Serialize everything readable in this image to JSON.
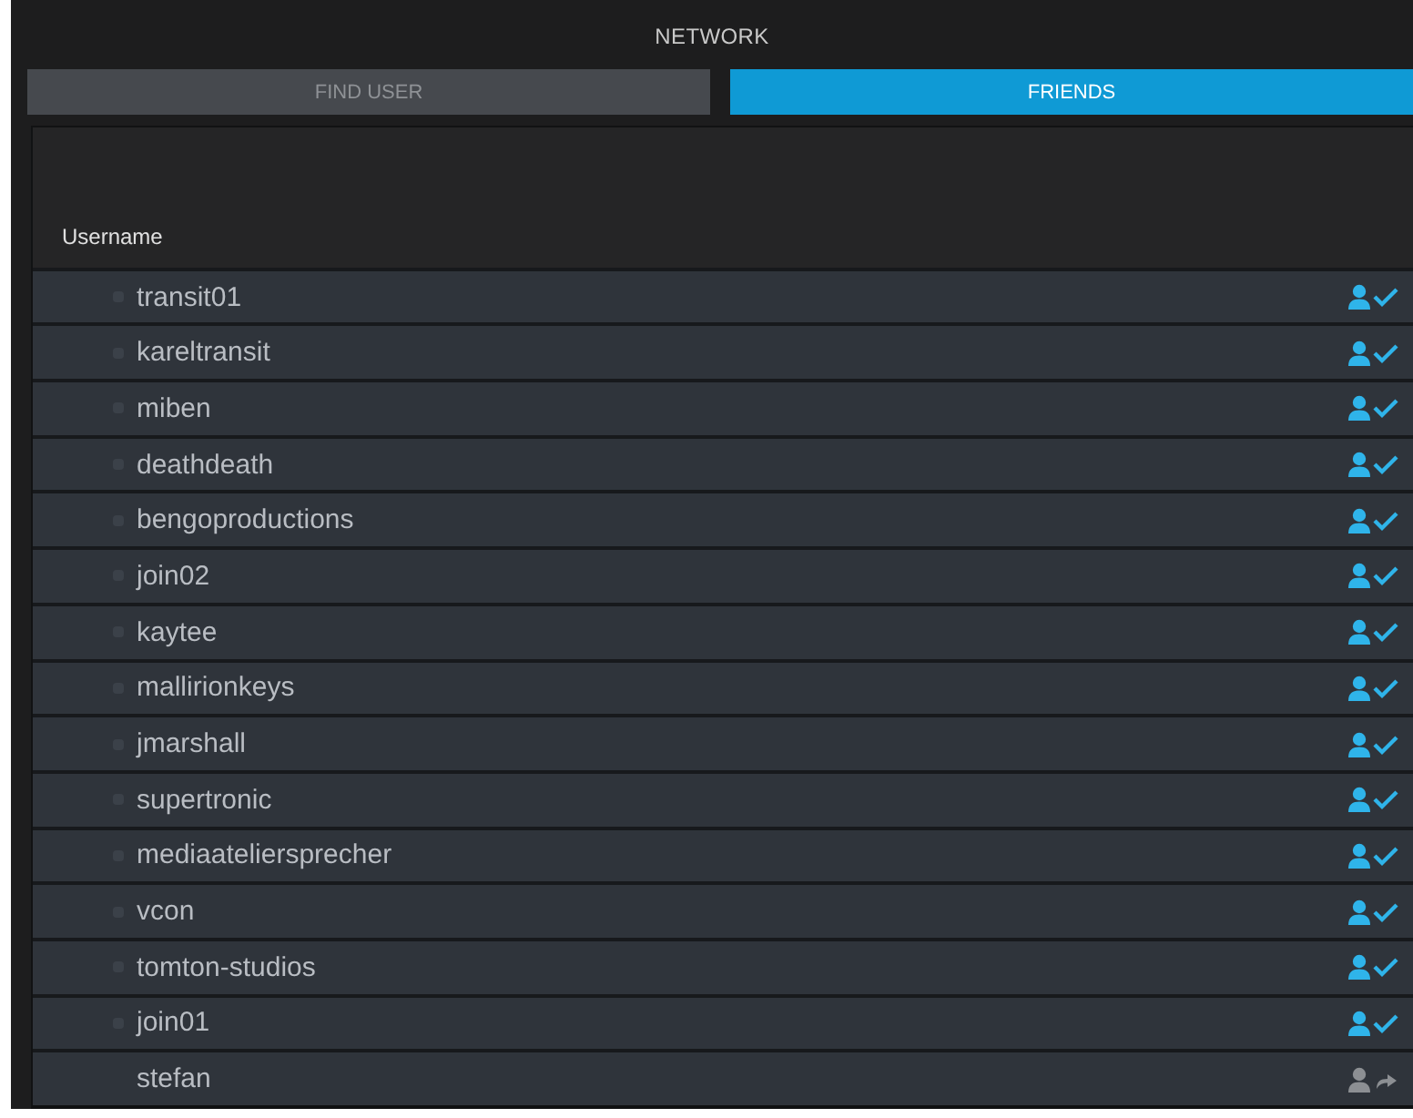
{
  "window": {
    "title": "NETWORK"
  },
  "tabs": [
    {
      "label": "FIND USER",
      "selected": false
    },
    {
      "label": "FRIENDS",
      "selected": true
    }
  ],
  "table": {
    "columns": [
      "Username"
    ],
    "rows": [
      {
        "username": "transit01",
        "marker": true,
        "kind": "friend"
      },
      {
        "username": "kareltransit",
        "marker": true,
        "kind": "friend"
      },
      {
        "username": "miben",
        "marker": true,
        "kind": "friend"
      },
      {
        "username": "deathdeath",
        "marker": true,
        "kind": "friend"
      },
      {
        "username": "bengoproductions",
        "marker": true,
        "kind": "friend"
      },
      {
        "username": "join02",
        "marker": true,
        "kind": "friend"
      },
      {
        "username": "kaytee",
        "marker": true,
        "kind": "friend"
      },
      {
        "username": "mallirionkeys",
        "marker": true,
        "kind": "friend"
      },
      {
        "username": "jmarshall",
        "marker": true,
        "kind": "friend"
      },
      {
        "username": "supertronic",
        "marker": true,
        "kind": "friend"
      },
      {
        "username": "mediaateliersprecher",
        "marker": true,
        "kind": "friend"
      },
      {
        "username": "vcon",
        "marker": true,
        "kind": "friend"
      },
      {
        "username": "tomton-studios",
        "marker": true,
        "kind": "friend"
      },
      {
        "username": "join01",
        "marker": true,
        "kind": "friend"
      },
      {
        "username": "stefan",
        "marker": false,
        "kind": "request"
      }
    ]
  }
}
